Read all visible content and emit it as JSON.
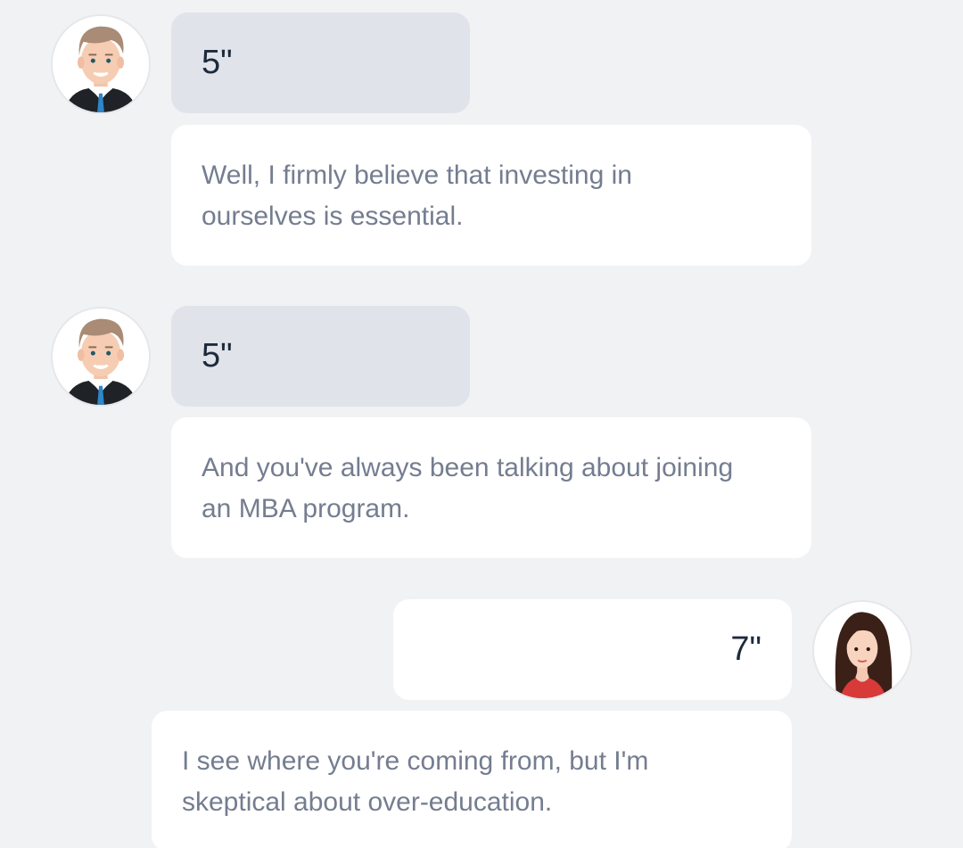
{
  "messages": [
    {
      "speaker": "male",
      "duration": "5\"",
      "text_lines": [
        "Well, I firmly believe that investing in",
        "ourselves is essential."
      ]
    },
    {
      "speaker": "male",
      "duration": "5\"",
      "text_lines": [
        "And you've always been talking about joining",
        "an MBA program."
      ]
    },
    {
      "speaker": "female",
      "duration": "7\"",
      "text_lines": [
        "I see where you're coming from, but I'm",
        "skeptical about over-education."
      ]
    }
  ],
  "icons": {
    "male": "male-avatar-icon",
    "female": "female-avatar-icon"
  },
  "colors": {
    "background": "#f1f2f4",
    "bubble_left": "#e0e4ea",
    "bubble_white": "#ffffff",
    "duration_text": "#1e2a3b",
    "message_text": "#747d90"
  }
}
